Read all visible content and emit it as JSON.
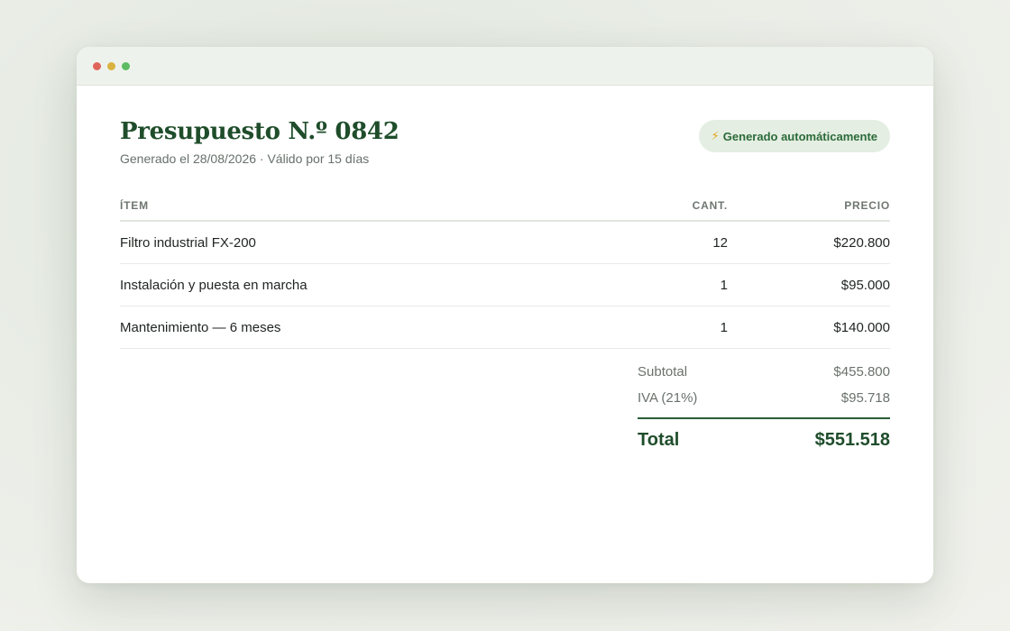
{
  "window": {
    "controls": [
      "close",
      "minimize",
      "maximize"
    ],
    "colors": {
      "close": "#e0645a",
      "minimize": "#d9b23f",
      "maximize": "#5dbb63"
    }
  },
  "header": {
    "title": "Presupuesto N.º 0842",
    "subtitle": "Generado el 28/08/2026 · Válido por 15 días",
    "badge_icon": "⚡",
    "badge_label": "Generado automáticamente"
  },
  "table": {
    "columns": {
      "item": "ÍTEM",
      "qty": "CANT.",
      "price": "PRECIO"
    },
    "rows": [
      {
        "item": "Filtro industrial FX-200",
        "qty": "12",
        "price": "$220.800"
      },
      {
        "item": "Instalación y puesta en marcha",
        "qty": "1",
        "price": "$95.000"
      },
      {
        "item": "Mantenimiento — 6 meses",
        "qty": "1",
        "price": "$140.000"
      }
    ]
  },
  "totals": {
    "subtotal_label": "Subtotal",
    "subtotal_value": "$455.800",
    "tax_label": "IVA (21%)",
    "tax_value": "$95.718",
    "total_label": "Total",
    "total_value": "$551.518"
  },
  "colors": {
    "accent": "#1f4d2b",
    "badge_bg": "#e4eee3",
    "badge_text": "#2c6a38"
  }
}
